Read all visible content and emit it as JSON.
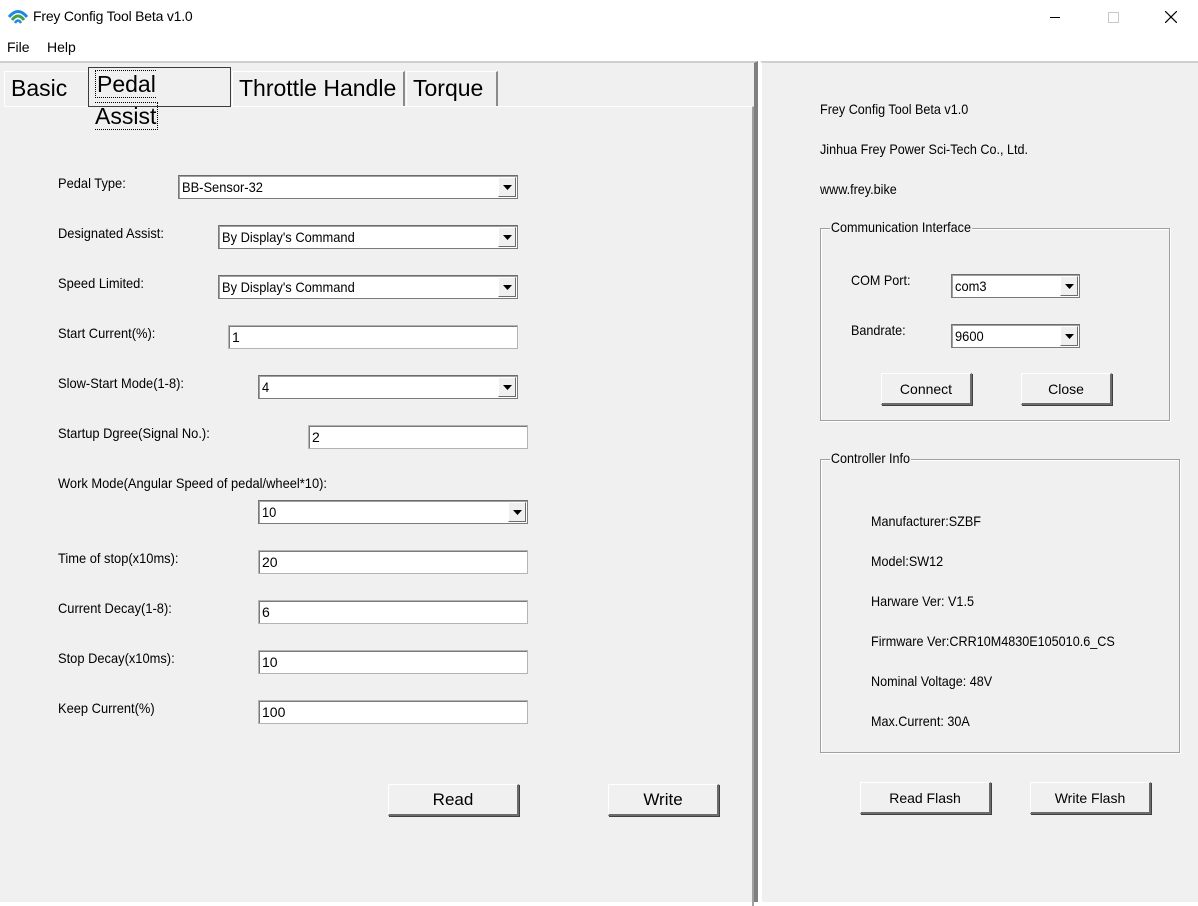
{
  "window": {
    "title": "Frey Config Tool Beta v1.0",
    "icon": "frey-logo-icon",
    "controls": [
      "minimize-icon",
      "maximize-icon",
      "close-icon"
    ]
  },
  "menu": {
    "file": "File",
    "help": "Help"
  },
  "tabs": [
    {
      "label": "Basic",
      "selected": false
    },
    {
      "label": "Pedal Assist",
      "selected": true
    },
    {
      "label": "Throttle Handle",
      "selected": false
    },
    {
      "label": "Torque",
      "selected": false
    }
  ],
  "pedal_assist": {
    "pedal_type": {
      "label": "Pedal Type:",
      "value": "BB-Sensor-32"
    },
    "designated_assist": {
      "label": "Designated Assist:",
      "value": "By Display's Command"
    },
    "speed_limited": {
      "label": "Speed Limited:",
      "value": "By Display's Command"
    },
    "start_current": {
      "label": "Start Current(%):",
      "value": "1"
    },
    "slow_start_mode": {
      "label": "Slow-Start Mode(1-8):",
      "value": "4"
    },
    "startup_degree": {
      "label": "Startup Dgree(Signal No.):",
      "value": "2"
    },
    "work_mode": {
      "label": "Work Mode(Angular Speed of pedal/wheel*10):",
      "value": "10"
    },
    "time_of_stop": {
      "label": "Time of stop(x10ms):",
      "value": "20"
    },
    "current_decay": {
      "label": "Current Decay(1-8):",
      "value": "6"
    },
    "stop_decay": {
      "label": "Stop Decay(x10ms):",
      "value": "10"
    },
    "keep_current": {
      "label": "Keep Current(%)",
      "value": "100"
    },
    "read_button": "Read",
    "write_button": "Write"
  },
  "about": {
    "app_name": "Frey Config Tool Beta v1.0",
    "company": "Jinhua Frey Power Sci-Tech Co., Ltd.",
    "website": "www.frey.bike"
  },
  "communication": {
    "legend": "Communication Interface",
    "com_port_label": "COM Port:",
    "com_port_value": "com3",
    "bandrate_label": "Bandrate:",
    "bandrate_value": "9600",
    "connect_button": "Connect",
    "close_button": "Close"
  },
  "controller_info": {
    "legend": "Controller Info",
    "manufacturer": "Manufacturer:SZBF",
    "model": "Model:SW12",
    "hardware_ver": "Harware Ver: V1.5",
    "firmware_ver": "Firmware Ver:CRR10M4830E105010.6_CS",
    "nominal_voltage": "Nominal Voltage: 48V",
    "max_current": "Max.Current: 30A"
  },
  "flash": {
    "read_button": "Read Flash",
    "write_button": "Write Flash"
  },
  "colors": {
    "face": "#f0f0f0",
    "shadow": "#6c6c6c",
    "logo_blue": "#1e88e5",
    "logo_green": "#43a047"
  }
}
